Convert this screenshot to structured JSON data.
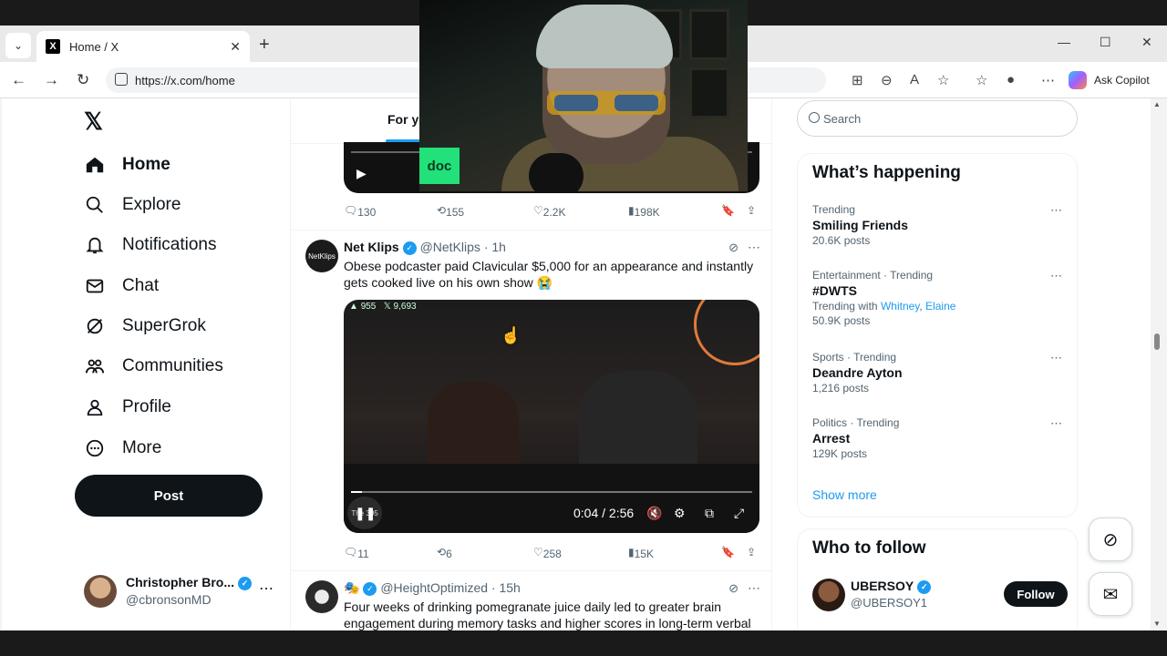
{
  "browser": {
    "tab_title": "Home / X",
    "tab_favicon": "X",
    "url": "https://x.com/home",
    "copilot_label": "Ask Copilot"
  },
  "nav": {
    "items": [
      {
        "label": "Home",
        "icon": "home-icon"
      },
      {
        "label": "Explore",
        "icon": "search-icon"
      },
      {
        "label": "Notifications",
        "icon": "bell-icon"
      },
      {
        "label": "Chat",
        "icon": "mail-icon"
      },
      {
        "label": "SuperGrok",
        "icon": "grok-icon"
      },
      {
        "label": "Communities",
        "icon": "communities-icon"
      },
      {
        "label": "Profile",
        "icon": "person-icon"
      },
      {
        "label": "More",
        "icon": "more-circle-icon"
      }
    ],
    "post_label": "Post",
    "user_name": "Christopher Bro...",
    "user_handle": "@cbronsonMD"
  },
  "feed": {
    "tab_label": "For yo",
    "tweet0_actions": {
      "replies": "130",
      "reposts": "155",
      "likes": "2.2K",
      "views": "198K"
    },
    "tweet1": {
      "name": "Net Klips",
      "handle": "@NetKlips",
      "time": "· 1h",
      "text": "Obese podcaster paid Clavicular $5,000 for an appearance and instantly gets cooked live on his own show 😭",
      "video_stats_likes": "955",
      "video_stats_views": "9,693",
      "video_time": "0:04 / 2:56",
      "video_brand": "The 305",
      "actions": {
        "replies": "11",
        "reposts": "6",
        "likes": "258",
        "views": "15K"
      }
    },
    "tweet2": {
      "handle": "@HeightOptimized",
      "time": "· 15h",
      "text": "Four weeks of drinking pomegranate juice daily led to greater brain engagement during memory tasks and higher scores in long-term verbal"
    }
  },
  "right": {
    "search_placeholder": "Search",
    "happening_title": "What’s happening",
    "trends": [
      {
        "category": "Trending",
        "title": "Smiling Friends",
        "count": "20.6K posts"
      },
      {
        "category": "Entertainment · Trending",
        "title": "#DWTS",
        "with_prefix": "Trending with ",
        "with_a": "Whitney",
        "with_sep": ", ",
        "with_b": "Elaine",
        "count": "50.9K posts"
      },
      {
        "category": "Sports · Trending",
        "title": "Deandre Ayton",
        "count": "1,216 posts"
      },
      {
        "category": "Politics · Trending",
        "title": "Arrest",
        "count": "129K posts"
      }
    ],
    "show_more": "Show more",
    "who_to_follow_title": "Who to follow",
    "follow_user": {
      "name": "UBERSOY",
      "handle": "@UBERSOY1",
      "button": "Follow"
    }
  },
  "webcam": {
    "label": "doc"
  },
  "colors": {
    "accent": "#1d9bf0",
    "text": "#0f1419",
    "muted": "#536471",
    "webcam_label": "#22e07a"
  }
}
